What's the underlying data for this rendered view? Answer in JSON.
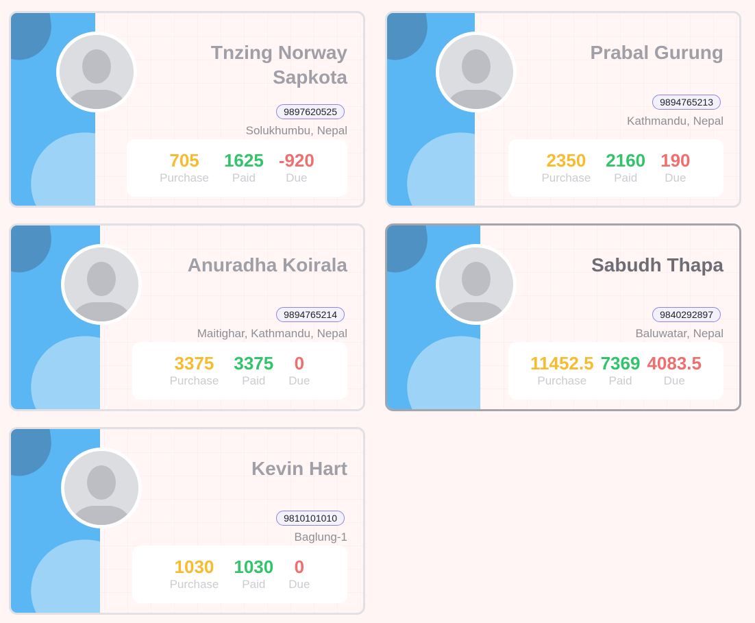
{
  "colors": {
    "purchase": "#f8bb2e",
    "paid": "#31c46a",
    "due": "#f06e6e"
  },
  "avatar_icon": "default-user-avatar-icon",
  "labels": {
    "purchase": "Purchase",
    "paid": "Paid",
    "due": "Due"
  },
  "customers": [
    {
      "name": "Tnzing Norway Sapkota",
      "phone": "9897620525",
      "address": "Solukhumbu, Nepal",
      "purchase": "705",
      "paid": "1625",
      "due": "-920",
      "selected": false
    },
    {
      "name": "Prabal Gurung",
      "phone": "9894765213",
      "address": "Kathmandu, Nepal",
      "purchase": "2350",
      "paid": "2160",
      "due": "190",
      "selected": false
    },
    {
      "name": "Anuradha Koirala",
      "phone": "9894765214",
      "address": "Maitighar, Kathmandu, Nepal",
      "purchase": "3375",
      "paid": "3375",
      "due": "0",
      "selected": false
    },
    {
      "name": "Sabudh Thapa",
      "phone": "9840292897",
      "address": "Baluwatar, Nepal",
      "purchase": "11452.5",
      "paid": "7369",
      "due": "4083.5",
      "selected": true
    },
    {
      "name": "Kevin Hart",
      "phone": "9810101010",
      "address": "Baglung-1",
      "purchase": "1030",
      "paid": "1030",
      "due": "0",
      "selected": false
    }
  ]
}
